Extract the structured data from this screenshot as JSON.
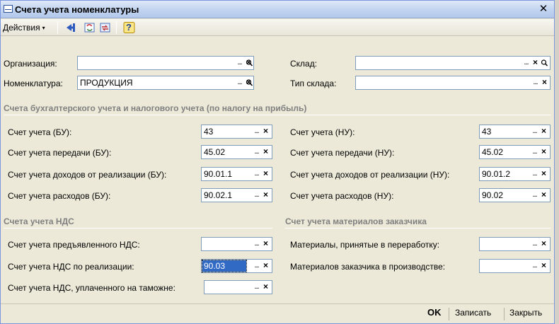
{
  "window": {
    "title": "Счета учета номенклатуры",
    "close": "✕"
  },
  "toolbar": {
    "actions_label": "Действия",
    "actions_arrow": "▾",
    "help": "?"
  },
  "filters": {
    "org_label": "Организация:",
    "org_value": "",
    "nom_label": "Номенклатура:",
    "nom_value": "ПРОДУКЦИЯ",
    "warehouse_label": "Склад:",
    "warehouse_value": "",
    "wh_type_label": "Тип склада:",
    "wh_type_value": ""
  },
  "field_buttons": {
    "dots": "...",
    "clear": "×",
    "search": "🔍"
  },
  "accounting": {
    "section_title": "Счета бухгалтерского учета и налогового учета (по налогу на прибыль)",
    "bu": [
      {
        "label": "Счет учета (БУ):",
        "value": "43"
      },
      {
        "label": "Счет учета передачи (БУ):",
        "value": "45.02"
      },
      {
        "label": "Счет учета доходов от реализации (БУ):",
        "value": "90.01.1"
      },
      {
        "label": "Счет учета расходов (БУ):",
        "value": "90.02.1"
      }
    ],
    "nu": [
      {
        "label": "Счет учета (НУ):",
        "value": "43"
      },
      {
        "label": "Счет учета передачи (НУ):",
        "value": "45.02"
      },
      {
        "label": "Счет учета доходов от реализации (НУ):",
        "value": "90.01.2"
      },
      {
        "label": "Счет учета расходов (НУ):",
        "value": "90.02"
      }
    ]
  },
  "vat": {
    "section_title": "Счета учета НДС",
    "rows": [
      {
        "label": "Счет учета предъявленного НДС:",
        "value": ""
      },
      {
        "label": "Счет учета НДС по реализации:",
        "value": "90.03"
      },
      {
        "label": "Счет учета НДС, уплаченного на таможне:",
        "value": ""
      }
    ]
  },
  "customer_materials": {
    "section_title": "Счет учета материалов заказчика",
    "rows": [
      {
        "label": "Материалы, принятые в переработку:",
        "value": ""
      },
      {
        "label": "Материалов заказчика в производстве:",
        "value": ""
      }
    ]
  },
  "footer": {
    "ok": "OK",
    "save": "Записать",
    "close": "Закрыть"
  }
}
